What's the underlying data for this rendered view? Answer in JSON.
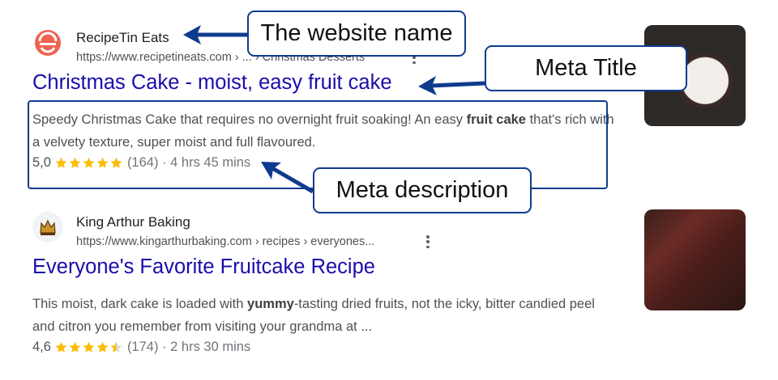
{
  "results": [
    {
      "site_name": "RecipeTin Eats",
      "url": "https://www.recipetineats.com › ... › Christmas Desserts",
      "title": "Christmas Cake - moist, easy fruit cake",
      "description_parts": [
        "Speedy Christmas Cake that requires no overnight fruit soaking! An easy ",
        "fruit cake",
        " that's rich with a velvety texture, super moist and full flavoured."
      ],
      "rating_score": "5,0",
      "rating_count": "(164)",
      "rating_suffix": "· 4 hrs 45 mins",
      "stars": 5.0
    },
    {
      "site_name": "King Arthur Baking",
      "url": "https://www.kingarthurbaking.com › recipes › everyones...",
      "title": "Everyone's Favorite Fruitcake Recipe",
      "description_parts": [
        "This moist, dark cake is loaded with ",
        "yummy",
        "-tasting dried fruits, not the icky, bitter candied peel and citron you remember from visiting your grandma at ..."
      ],
      "rating_score": "4,6",
      "rating_count": "(174)",
      "rating_suffix": "· 2 hrs 30 mins",
      "stars": 4.5
    }
  ],
  "annotations": {
    "website_name": "The website name",
    "meta_title": "Meta Title",
    "meta_description": "Meta description"
  },
  "colors": {
    "title_link": "#1a0dab",
    "annotation_border": "#0e3b8e",
    "star": "#fbbc04",
    "favicon_red": "#ef6351"
  },
  "icons": {
    "favicon_1": "recipetin-logo-icon",
    "favicon_2": "king-arthur-crown-icon",
    "menu": "more-vert-icon",
    "star": "star-icon"
  }
}
